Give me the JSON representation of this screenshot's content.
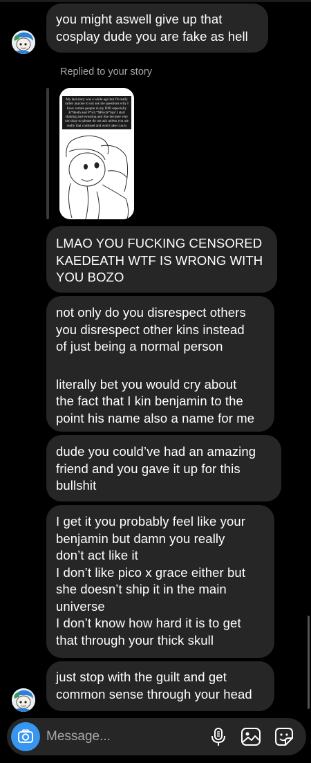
{
  "thread": {
    "reply_label": "Replied to your story",
    "story_preview_text": "My last story was a while ago but I'd really rather anyone to not ask me questions why I have certain people in my DNI especially K*death and P*a/L*$PicoS*mp! I start shaking and sweating and like become very not okay so please do not ask unless you are really that confused and won't take it as is",
    "messages": [
      {
        "lines": [
          "you might aswell give up that",
          "cosplay dude you are fake as hell"
        ]
      },
      {
        "lines": [
          "LMAO YOU FUCKING CENSORED",
          "KAEDEATH WTF IS WRONG WITH",
          "YOU BOZO"
        ]
      },
      {
        "lines": [
          "not only do you disrespect others",
          "you disrespect other kins instead",
          "of just being a normal person"
        ],
        "lines2": [
          "literally bet you would cry about",
          "the fact that I kin benjamin to the",
          "point his name also a name for me"
        ]
      },
      {
        "lines": [
          "dude you could’ve had an amazing",
          "friend and you gave it up for this",
          "bullshit"
        ]
      },
      {
        "lines": [
          "I get it you probably feel like your",
          "benjamin but damn you really",
          "don’t act like it",
          "I don’t like pico x grace either but",
          "she doesn’t ship it in the main",
          "universe",
          "I don’t know how hard it is to get",
          "that through your thick skull"
        ]
      },
      {
        "lines": [
          "just stop with the guilt and get",
          "common sense through your head"
        ]
      }
    ]
  },
  "composer": {
    "placeholder": "Message..."
  },
  "icons": {
    "camera": "camera-icon",
    "microphone": "microphone-icon",
    "gallery": "gallery-icon",
    "sticker": "sticker-icon",
    "avatar": "avatar-image"
  },
  "colors": {
    "background": "#000000",
    "bubble": "#262626",
    "accent": "#3797f0",
    "muted_text": "#a8a8a8"
  }
}
